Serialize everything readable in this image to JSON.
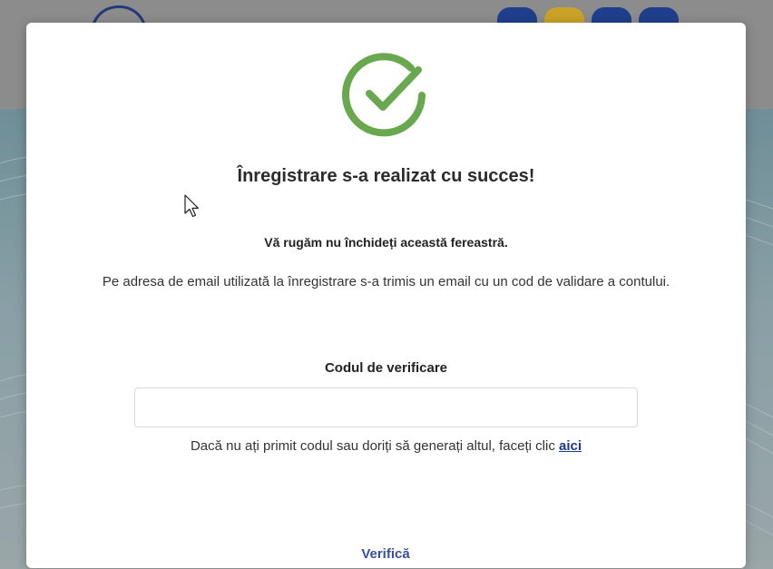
{
  "modal": {
    "title": "Înregistrare s-a realizat cu succes!",
    "warning": "Vă rugăm nu închideți această fereastră.",
    "info": "Pe adresa de email utilizată la înregistrare s-a trimis un email cu un cod de validare a contului.",
    "code_label": "Codul de verificare",
    "code_input": {
      "value": "",
      "placeholder": ""
    },
    "resend_text": "Dacă nu ați primit codul sau doriți să generați altul, faceți clic",
    "resend_link": "aici",
    "verify_button": "Verifică"
  },
  "icons": {
    "success": "check-circle-icon",
    "cursor": "mouse-pointer-icon"
  },
  "colors": {
    "success_green": "#6aa84f",
    "link_blue": "#1a3a8f",
    "button_text": "#3b4fa0",
    "overlay": "#7a8a8d"
  }
}
